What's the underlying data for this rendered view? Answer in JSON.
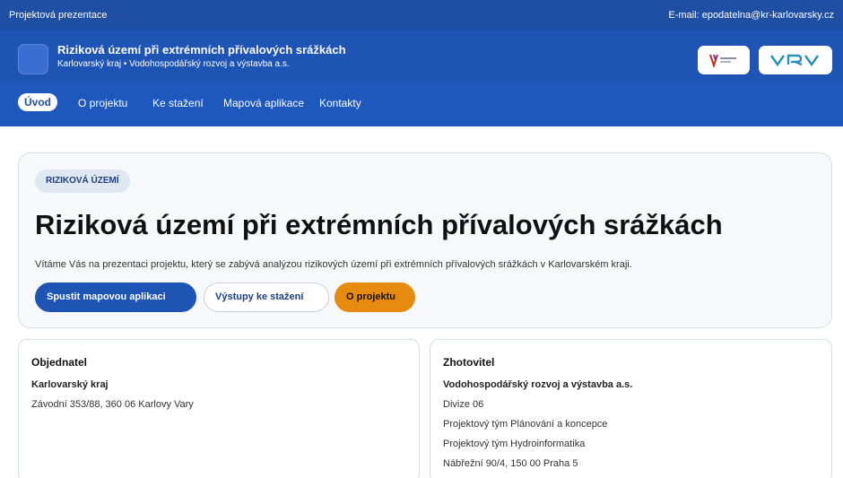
{
  "topbar": {
    "site_name": "Projektová prezentace",
    "email": "E-mail: epodatelna@kr-karlovarsky.cz"
  },
  "header": {
    "title": "Riziková území při extrémních přívalových srážkách",
    "subtitle": "Karlovarský kraj • Vodohospodářský rozvoj a výstavba a.s.",
    "partner_logos": [
      "karlovarsky-kraj-logo",
      "vrv-logo"
    ],
    "vrv_logo_text": "VRV"
  },
  "nav": {
    "items": [
      {
        "label": "Úvod",
        "active": true
      },
      {
        "label": "O projektu",
        "active": false
      },
      {
        "label": "Ke stažení",
        "active": false
      },
      {
        "label": "Mapová aplikace",
        "active": false
      },
      {
        "label": "Kontakty",
        "active": false
      }
    ]
  },
  "hero": {
    "badge": "RIZIKOVÁ ÚZEMÍ",
    "heading": "Riziková území při extrémních přívalových srážkách",
    "description": "Vítáme Vás na prezentaci projektu, který se zabývá analýzou rizikových území při extrémních přívalových srážkách v Karlovarském kraji.",
    "buttons": {
      "map_app": "Spustit mapovou aplikaci",
      "downloads": "Výstupy ke stažení",
      "about": "O projektu"
    }
  },
  "client": {
    "title": "Objednatel",
    "name": "Karlovarský kraj",
    "address": "Závodní 353/88, 360 06 Karlovy Vary"
  },
  "contractor": {
    "title": "Zhotovitel",
    "name": "Vodohospodářský rozvoj a výstavba a.s.",
    "lines": [
      "Divize 06",
      "Projektový tým Plánování a koncepce",
      "Projektový tým Hydroinformatika",
      "Nábřežní 90/4, 150 00 Praha 5"
    ]
  },
  "colors": {
    "primary": "#1e54b4",
    "topbar": "#1e4fa3",
    "accent_orange": "#e78b10",
    "background": "#ffffff"
  }
}
